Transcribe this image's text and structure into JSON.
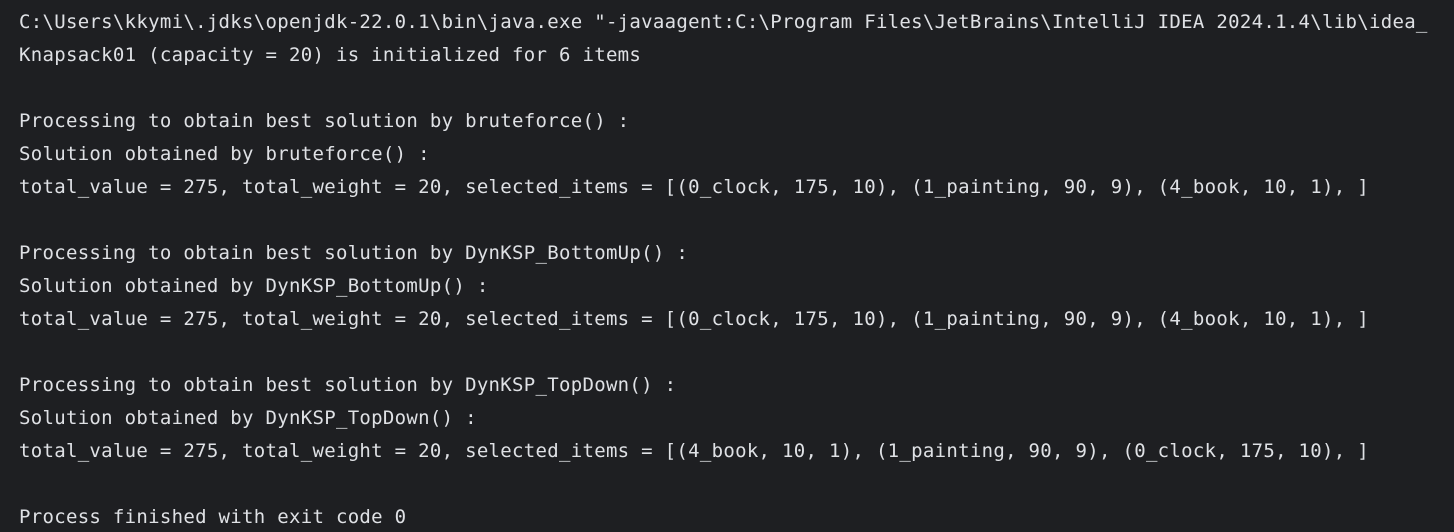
{
  "console": {
    "lines": [
      "C:\\Users\\kkymi\\.jdks\\openjdk-22.0.1\\bin\\java.exe \"-javaagent:C:\\Program Files\\JetBrains\\IntelliJ IDEA 2024.1.4\\lib\\idea_",
      "Knapsack01 (capacity = 20) is initialized for 6 items",
      "",
      "Processing to obtain best solution by bruteforce() :",
      "Solution obtained by bruteforce() :",
      "total_value = 275, total_weight = 20, selected_items = [(0_clock, 175, 10), (1_painting, 90, 9), (4_book, 10, 1), ]",
      "",
      "Processing to obtain best solution by DynKSP_BottomUp() :",
      "Solution obtained by DynKSP_BottomUp() :",
      "total_value = 275, total_weight = 20, selected_items = [(0_clock, 175, 10), (1_painting, 90, 9), (4_book, 10, 1), ]",
      "",
      "Processing to obtain best solution by DynKSP_TopDown() :",
      "Solution obtained by DynKSP_TopDown() :",
      "total_value = 275, total_weight = 20, selected_items = [(4_book, 10, 1), (1_painting, 90, 9), (0_clock, 175, 10), ]",
      "",
      "Process finished with exit code 0"
    ]
  }
}
